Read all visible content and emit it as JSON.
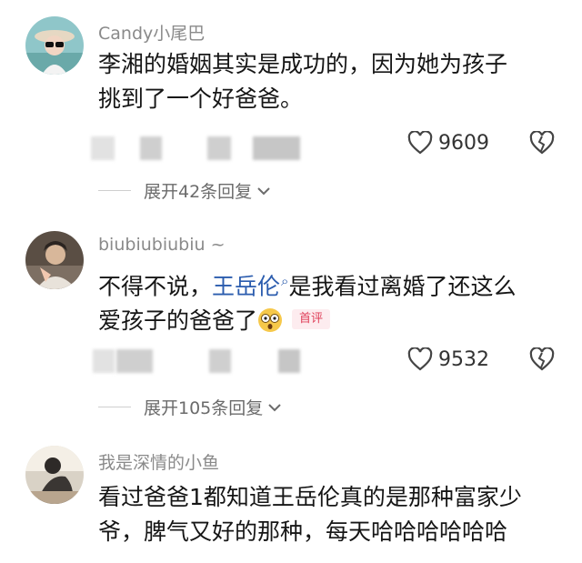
{
  "comments": [
    {
      "username": "Candy小尾巴",
      "text_lines": [
        "李湘的婚姻其实是成功的，因为她为孩子",
        "挑到了一个好爸爸。"
      ],
      "likes": "9609",
      "replies_label": "展开42条回复"
    },
    {
      "username": "biubiubiubiu ~",
      "text_prefix": "不得不说，",
      "mention": "王岳伦",
      "text_suffix": "是我看过离婚了还这么",
      "text_line2": "爱孩子的爸爸了",
      "badge": "首评",
      "likes": "9532",
      "replies_label": "展开105条回复"
    },
    {
      "username": "我是深情的小鱼",
      "text_lines": [
        "看过爸爸1都知道王岳伦真的是那种富家少",
        "爷，脾气又好的那种，每天哈哈哈哈哈哈"
      ]
    }
  ],
  "colors": {
    "username": "#8a8a8a",
    "mention": "#2b5cae",
    "badge_text": "#e0405a",
    "badge_bg": "#fdecef"
  },
  "icons": {
    "like": "heart-outline-icon",
    "dislike": "broken-heart-icon",
    "mention": "search-mention-icon",
    "expand": "chevron-down-icon"
  }
}
